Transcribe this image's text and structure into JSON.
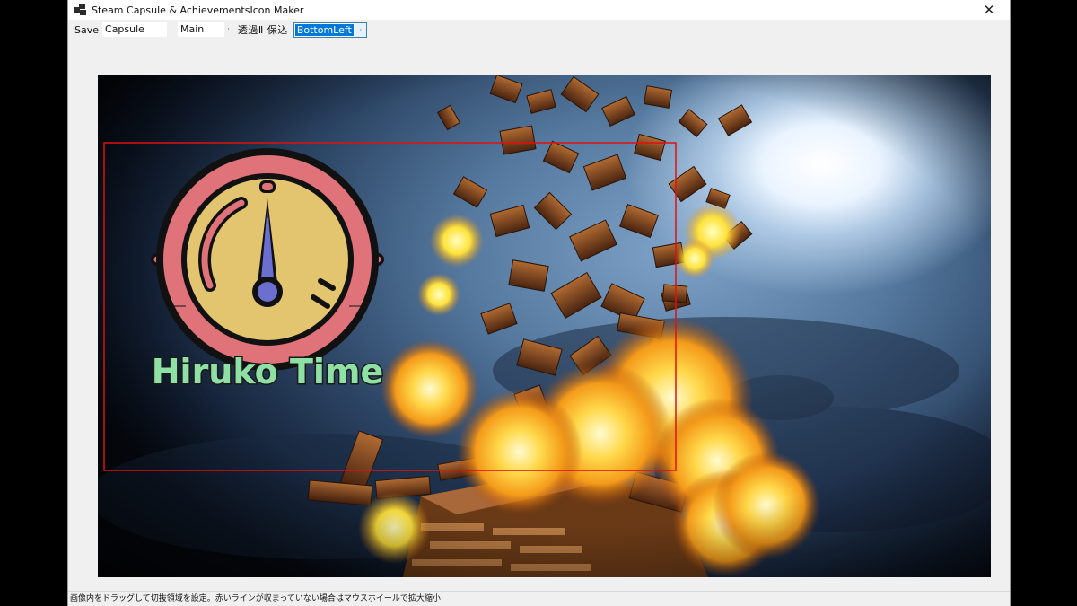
{
  "window": {
    "title": "Steam Capsule & AchievementsIcon Maker",
    "close_glyph": "✕",
    "icon": "app-window-icon"
  },
  "toolbar": {
    "save_label": "Save",
    "name_value": "Capsule",
    "mode_value": "Main",
    "separator_glyph": "·",
    "check_label": "透過Ⅱ 保込",
    "position_value": "BottomLeft",
    "dropdown_glyph": "·"
  },
  "artwork": {
    "logo_text": "Hiruko Time",
    "colors": {
      "dial_ring": "#e0737a",
      "dial_face": "#e3c56f",
      "hand": "#6b6fd0",
      "logo_text": "#8fe0a4",
      "crop_rect": "#e01010"
    }
  },
  "status": {
    "message": "画像内をドラッグして切抜領域を設定。赤いラインが収まっていない場合はマウスホイールで拡大縮小"
  }
}
